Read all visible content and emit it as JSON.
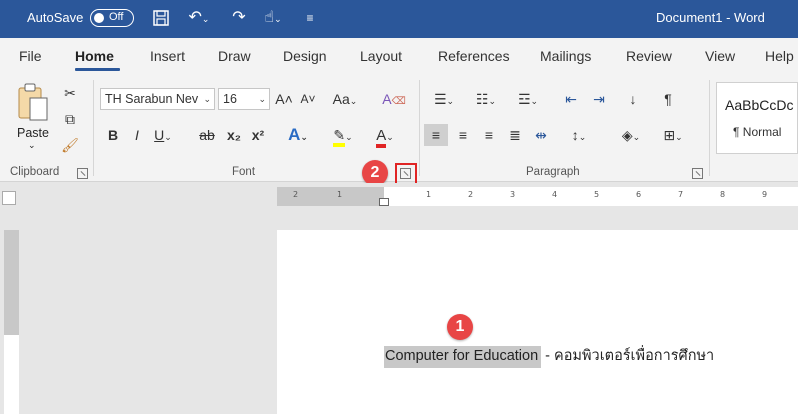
{
  "titlebar": {
    "autosave_label": "AutoSave",
    "autosave_state": "Off",
    "doc_title": "Document1  -  Word"
  },
  "tabs": [
    "File",
    "Home",
    "Insert",
    "Draw",
    "Design",
    "Layout",
    "References",
    "Mailings",
    "Review",
    "View",
    "Help"
  ],
  "active_tab": "Home",
  "clipboard": {
    "paste_label": "Paste",
    "group_label": "Clipboard"
  },
  "font": {
    "family": "TH Sarabun Nev",
    "size": "16",
    "grow": "A˄",
    "shrink": "A˅",
    "case": "Aa",
    "bold": "B",
    "italic": "I",
    "underline": "U",
    "strike": "ab",
    "subscript": "x₂",
    "superscript": "x²",
    "text_effects": "A",
    "font_color": "A",
    "group_label": "Font"
  },
  "paragraph": {
    "group_label": "Paragraph",
    "pilcrow": "¶"
  },
  "styles": {
    "sample": "AaBbCcDc",
    "normal": "¶ Normal"
  },
  "ruler": {
    "left_ticks": [
      "2",
      "1"
    ],
    "right_ticks": [
      "1",
      "2",
      "3",
      "4",
      "5",
      "6",
      "7",
      "8",
      "9"
    ]
  },
  "document": {
    "selected_text": "Computer for Education",
    "rest_text": " - คอมพิวเตอร์เพื่อการศึกษา"
  },
  "callouts": {
    "one": "1",
    "two": "2"
  },
  "colors": {
    "word_blue": "#2b579a",
    "callout_red": "#e84545",
    "highlight": "#ffff00",
    "font_red": "#e02424"
  }
}
